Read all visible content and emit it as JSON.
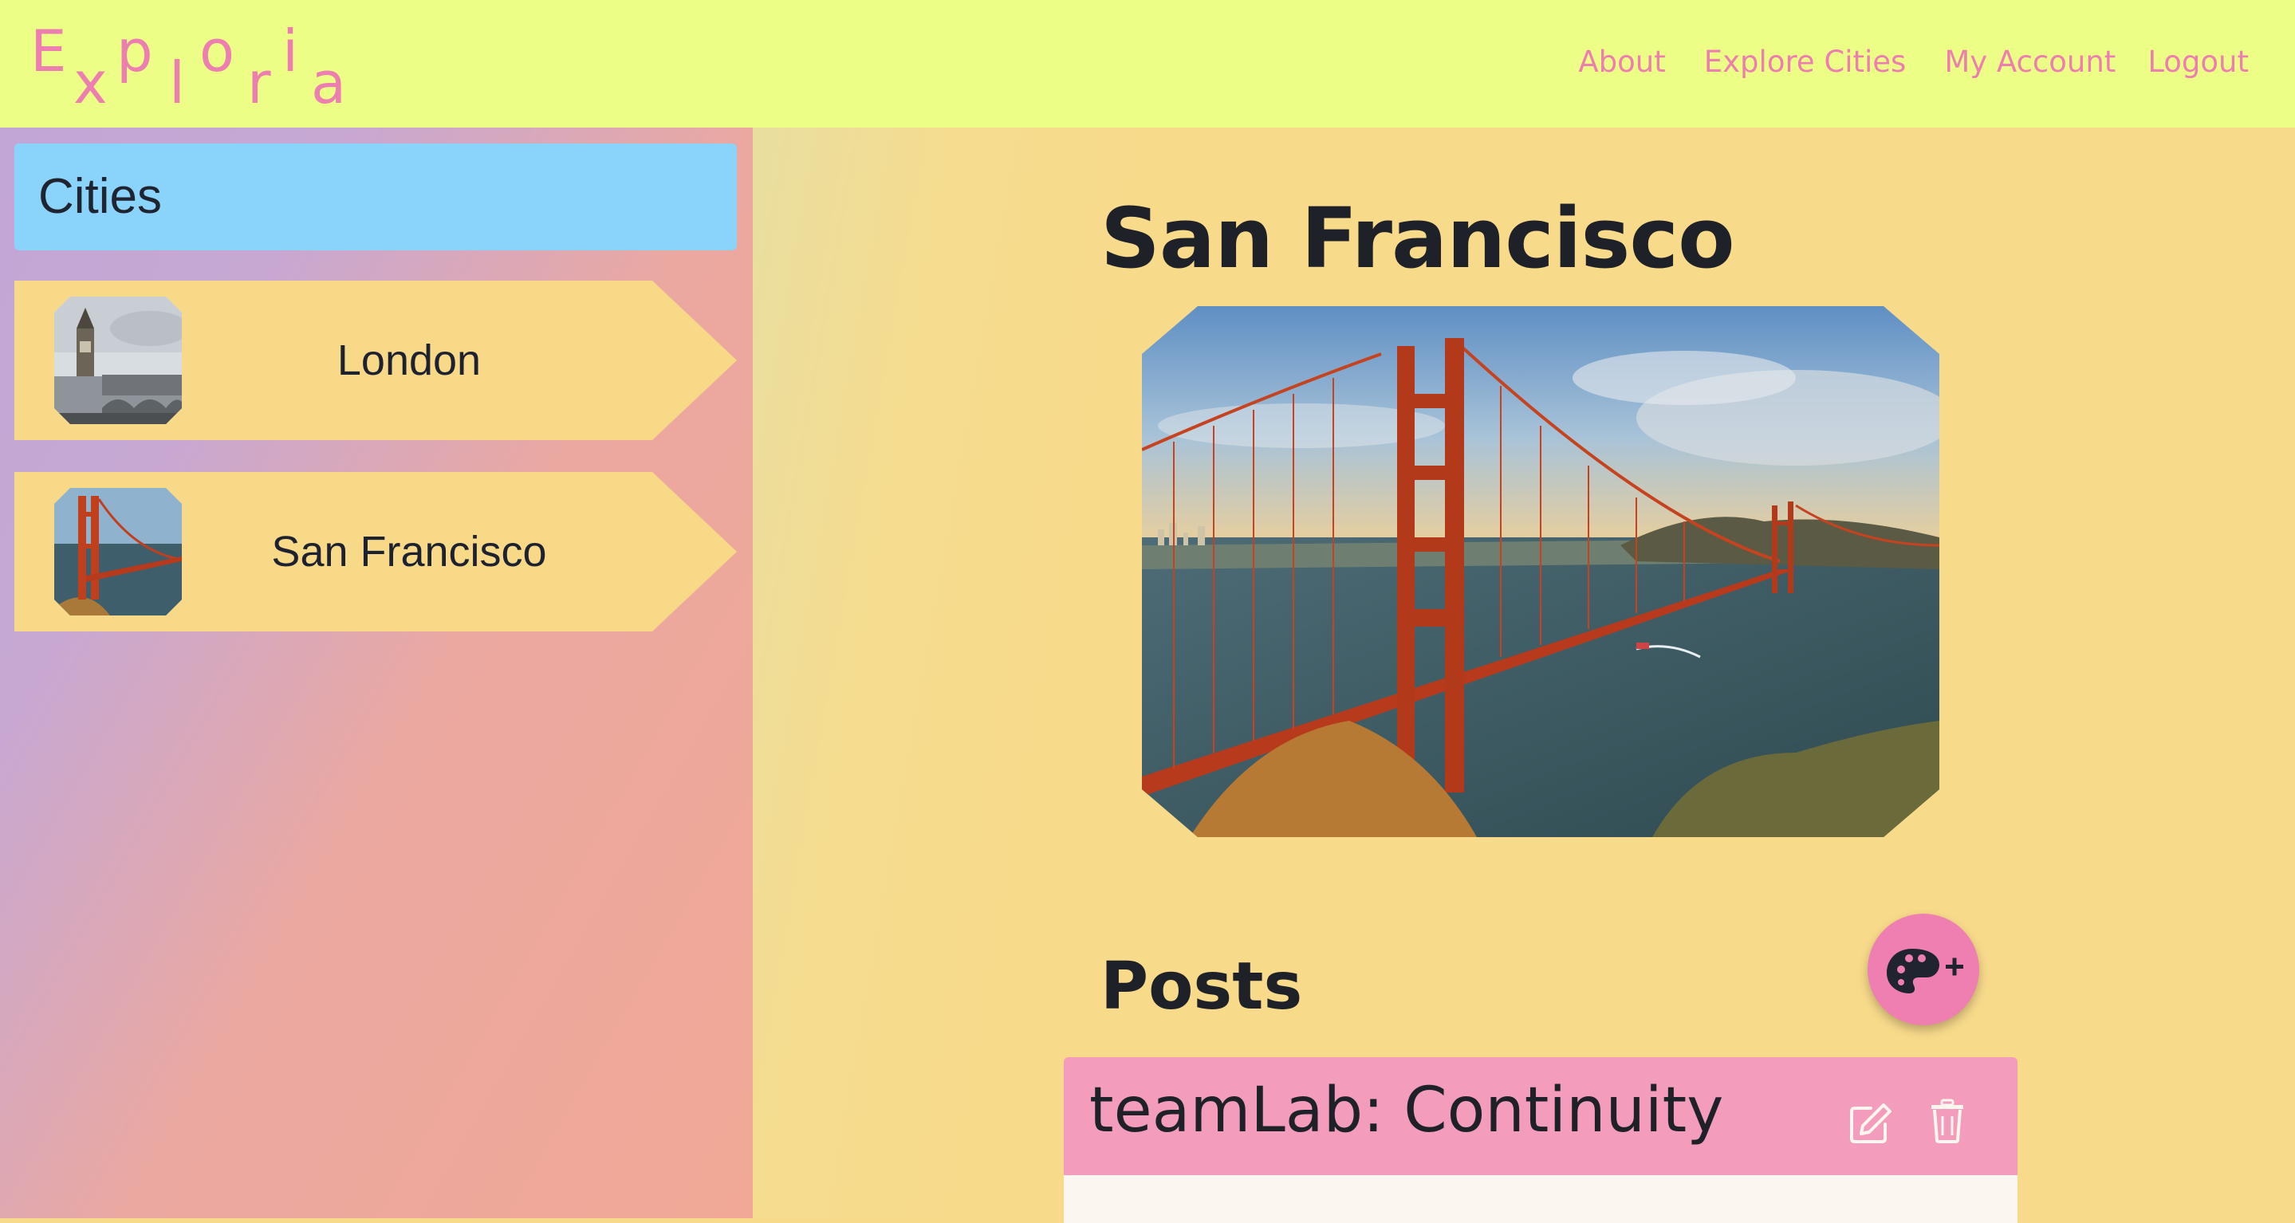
{
  "app": {
    "logo_letters": [
      "E",
      "x",
      "p",
      "l",
      "o",
      "r",
      "i",
      "a"
    ],
    "logo_text": "Exploria",
    "accent_color": "#ec7fb0",
    "header_color": "#ecfe86"
  },
  "nav": {
    "about": "About",
    "explore": "Explore Cities",
    "account": "My Account",
    "logout": "Logout"
  },
  "sidebar": {
    "title": "Cities",
    "cities": [
      {
        "name": "London",
        "thumb_icon": "big-ben-photo"
      },
      {
        "name": "San Francisco",
        "thumb_icon": "golden-gate-photo"
      }
    ]
  },
  "main": {
    "city_title": "San Francisco",
    "hero_image": "golden-gate-bridge-photo",
    "posts_heading": "Posts",
    "fab_icon": "palette-plus-icon",
    "posts": [
      {
        "title": "teamLab: Continuity",
        "edit_icon": "edit-icon",
        "delete_icon": "trash-icon"
      }
    ]
  }
}
